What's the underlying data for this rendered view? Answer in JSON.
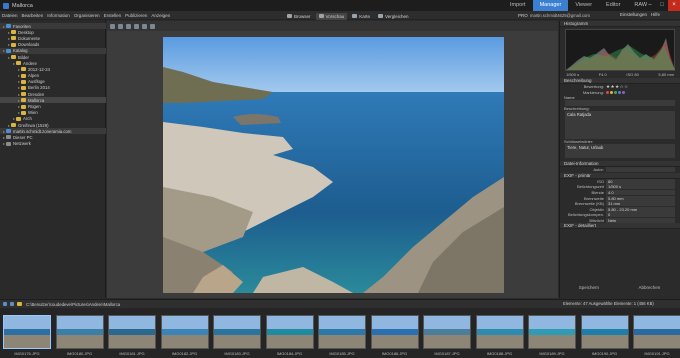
{
  "window": {
    "title": "Mallorca"
  },
  "mode_tabs": [
    "Import",
    "Manager",
    "Viewer",
    "Editor",
    "RAW"
  ],
  "active_mode": "Manager",
  "menu": [
    "Dateien",
    "Bearbeiten",
    "Information",
    "Organisieren",
    "Erstellen",
    "Publizieren",
    "Anzeigen"
  ],
  "view_buttons": [
    "Browser",
    "Vorschau",
    "Karte",
    "Vergleichen"
  ],
  "account": {
    "badge": "PRO",
    "email": "martin.schmidt4625@gmail.com",
    "settings": "Einstellungen",
    "help": "Hilfe"
  },
  "folders": [
    {
      "label": "Favoriten",
      "level": 0,
      "type": "section"
    },
    {
      "label": "Desktop",
      "level": 1
    },
    {
      "label": "Dokumente",
      "level": 1
    },
    {
      "label": "Downloads",
      "level": 1
    },
    {
      "label": "Katalog",
      "level": 0,
      "type": "section"
    },
    {
      "label": "Bilder",
      "level": 1
    },
    {
      "label": "Andere",
      "level": 2
    },
    {
      "label": "2012-12-24",
      "level": 3
    },
    {
      "label": "Alpen",
      "level": 3
    },
    {
      "label": "Ausflüge",
      "level": 3
    },
    {
      "label": "Berlin 2014",
      "level": 3
    },
    {
      "label": "Dresden",
      "level": 3
    },
    {
      "label": "Mallorca",
      "level": 3,
      "selected": true
    },
    {
      "label": "Rügen",
      "level": 3
    },
    {
      "label": "Wien",
      "level": 3
    },
    {
      "label": "Arch",
      "level": 2
    },
    {
      "label": "Greifswa (1528)",
      "level": 1
    },
    {
      "label": "martin.schmidt.zoneramia.com",
      "level": 0,
      "type": "section"
    },
    {
      "label": "Dieser PC",
      "level": 0
    },
    {
      "label": "Netzwerk",
      "level": 0
    }
  ],
  "right_panel": {
    "histogram_title": "Histogramm",
    "exposure": [
      "1/500 s",
      "F4.0",
      "ISO 80",
      "5,80 mm"
    ],
    "description_title": "Beschreibung",
    "rating_label": "Bewertung:",
    "stars": "★★★☆☆",
    "marker_label": "Markierung:",
    "name_label": "Name",
    "name_value": "",
    "desc_label": "Beschreibung:",
    "desc_value": "Cala Ratjada",
    "keywords_label": "Schlüsselwörter:",
    "keywords_value": "Tiere, Natur, Urlaub",
    "info_title": "Datei-Information",
    "author_label": "Autor:",
    "exif_title": "EXIF - primär",
    "exif": [
      {
        "k": "ISO",
        "v": "80"
      },
      {
        "k": "Belichtungszeit",
        "v": "1/500 s"
      },
      {
        "k": "Blende",
        "v": "4.0"
      },
      {
        "k": "Brennweite",
        "v": "5.80 mm"
      },
      {
        "k": "Brennweite (KB)",
        "v": "31 mm"
      },
      {
        "k": "Objektiv",
        "v": "5.80 - 23.20 mm"
      },
      {
        "k": "Belichtungskompen.",
        "v": "0"
      },
      {
        "k": "Blitzlicht",
        "v": "Nein"
      }
    ],
    "exif_detail_title": "EXIF - detailliert",
    "save_button": "Speichern",
    "cancel_button": "Abbrechen"
  },
  "path": "C:\\Benutzer\\coudedeve\\Pictures\\Andere\\Mallorca",
  "status": "Elemente: 47    Ausgewählte Elemente: 1 (456 KB)",
  "thumbnails": [
    "IMG0176.JPG",
    "IMG0180.JPG",
    "IMG0181.JPG",
    "IMG0182.JPG",
    "IMG0183.JPG",
    "IMG0184.JPG",
    "IMG0185.JPG",
    "IMG0186.JPG",
    "IMG0187.JPG",
    "IMG0188.JPG",
    "IMG0189.JPG",
    "IMG0190.JPG",
    "IMG0191.JPG"
  ],
  "selected_thumbnail": "IMG0176.JPG",
  "colors": {
    "accent": "#3b7fd1",
    "panel": "#2b2b2b",
    "viewer_bg": "#3c3c3c"
  }
}
